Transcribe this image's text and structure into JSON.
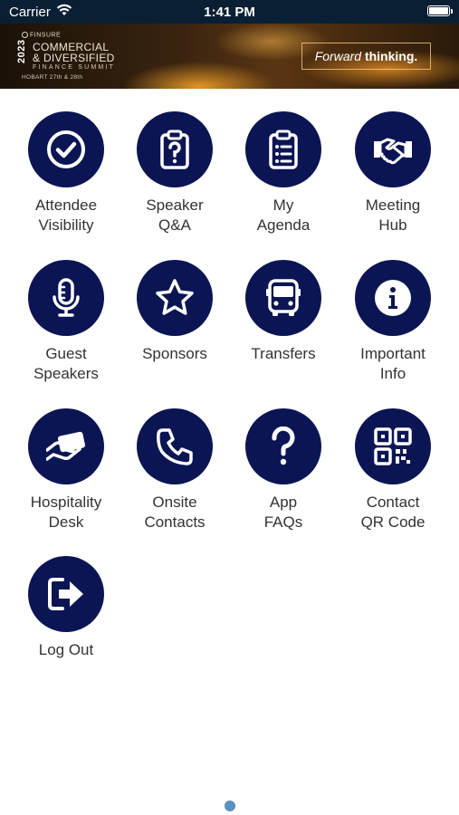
{
  "status_bar": {
    "carrier": "Carrier",
    "time": "1:41 PM"
  },
  "banner": {
    "brand": "FINSURE",
    "year": "2023",
    "title_line1": "COMMERCIAL",
    "title_line2": "& DIVERSIFIED",
    "title_line3": "FINANCE SUMMIT",
    "dates": "HOBART 27th & 28th",
    "tagline_light": "Forward",
    "tagline_bold": "thinking."
  },
  "menu": [
    {
      "line1": "Attendee",
      "line2": "Visibility",
      "icon": "check-circle-icon"
    },
    {
      "line1": "Speaker",
      "line2": "Q&A",
      "icon": "clipboard-question-icon"
    },
    {
      "line1": "My",
      "line2": "Agenda",
      "icon": "clipboard-list-icon"
    },
    {
      "line1": "Meeting",
      "line2": "Hub",
      "icon": "handshake-icon"
    },
    {
      "line1": "Guest",
      "line2": "Speakers",
      "icon": "microphone-icon"
    },
    {
      "line1": "Sponsors",
      "line2": "",
      "icon": "star-icon"
    },
    {
      "line1": "Transfers",
      "line2": "",
      "icon": "bus-icon"
    },
    {
      "line1": "Important",
      "line2": "Info",
      "icon": "info-icon"
    },
    {
      "line1": "Hospitality",
      "line2": "Desk",
      "icon": "hand-holding-card-icon"
    },
    {
      "line1": "Onsite",
      "line2": "Contacts",
      "icon": "phone-icon"
    },
    {
      "line1": "App",
      "line2": "FAQs",
      "icon": "question-mark-icon"
    },
    {
      "line1": "Contact",
      "line2": "QR Code",
      "icon": "qr-code-icon"
    },
    {
      "line1": "Log Out",
      "line2": "",
      "icon": "logout-icon"
    }
  ],
  "colors": {
    "icon_circle": "#0b1554",
    "status_bar": "#0a1f33",
    "page_indicator": "#5a8fc0"
  }
}
